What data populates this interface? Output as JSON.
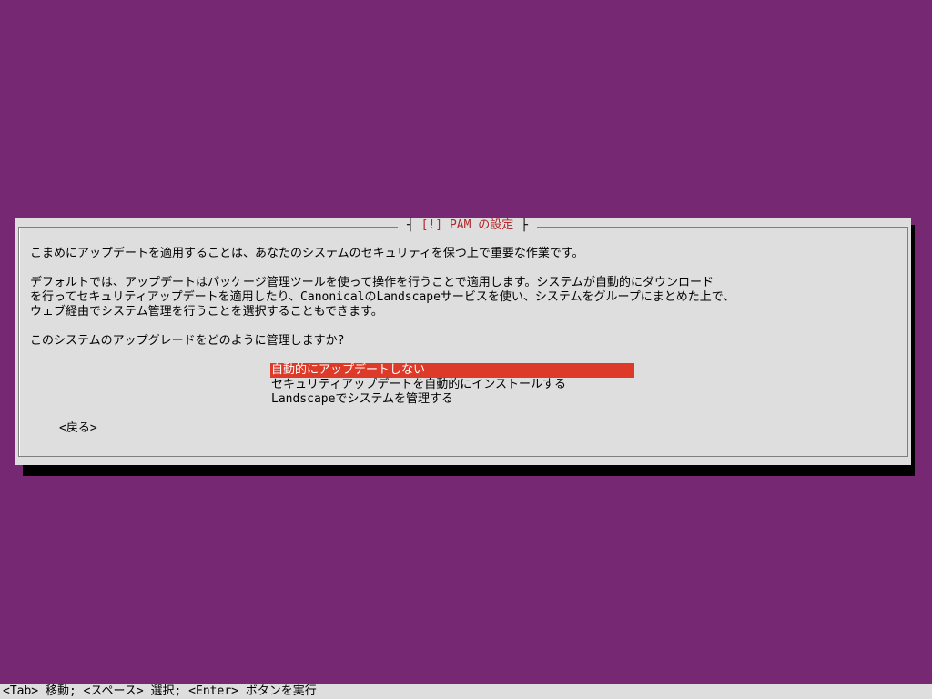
{
  "dialog": {
    "title_open": "[!]",
    "title_text": "PAM の設定",
    "paragraph_1": "こまめにアップデートを適用することは、あなたのシステムのセキュリティを保つ上で重要な作業です。",
    "paragraph_2_line_1": "デフォルトでは、アップデートはパッケージ管理ツールを使って操作を行うことで適用します。システムが自動的にダウンロード",
    "paragraph_2_line_2": "を行ってセキュリティアップデートを適用したり、CanonicalのLandscapeサービスを使い、システムをグループにまとめた上で、",
    "paragraph_2_line_3": "ウェブ経由でシステム管理を行うことを選択することもできます。",
    "question": "このシステムのアップグレードをどのように管理しますか?",
    "options": [
      "自動的にアップデートしない",
      "セキュリティアップデートを自動的にインストールする",
      "Landscapeでシステムを管理する"
    ],
    "selected_index": 0,
    "back_label": "<戻る>"
  },
  "footer": {
    "help_text": "<Tab> 移動; <スペース> 選択; <Enter> ボタンを実行"
  },
  "colors": {
    "background": "#772872",
    "dialog": "#dedede",
    "highlight": "#dd3a2a",
    "title": "#b0262b"
  }
}
